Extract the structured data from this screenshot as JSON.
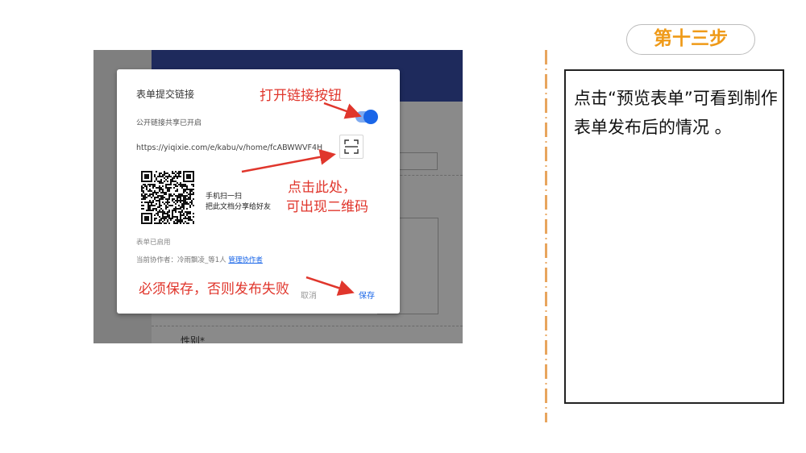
{
  "background_form": {
    "gender_label": "性别*"
  },
  "dialog": {
    "title": "表单提交链接",
    "share_status": "公开链接共享已开启",
    "toggle_on": true,
    "link_url": "https://yiqixie.com/e/kabu/v/home/fcABWWVF4H",
    "qr_text_line1": "手机扫一扫",
    "qr_text_line2": "把此文档分享给好友",
    "form_status": "表单已启用",
    "collaborators_prefix": "当前协作者：冷雨飘凌_等1人",
    "manage_collaborators": "管理协作者",
    "cancel_label": "取消",
    "save_label": "保存"
  },
  "annotations": {
    "open_link_toggle": "打开链接按钮",
    "click_here_line1": "点击此处，",
    "click_here_line2": "可出现二维码",
    "must_save": "必须保存，否则发布失败"
  },
  "step_panel": {
    "step_label": "第十三步",
    "description": "点击“预览表单”可看到制作表单发布后的情况 。"
  },
  "colors": {
    "annotation_red": "#e0362c",
    "accent_blue": "#1a66e8",
    "step_orange": "#ef9a18",
    "navy_header": "#1e2a5c"
  }
}
